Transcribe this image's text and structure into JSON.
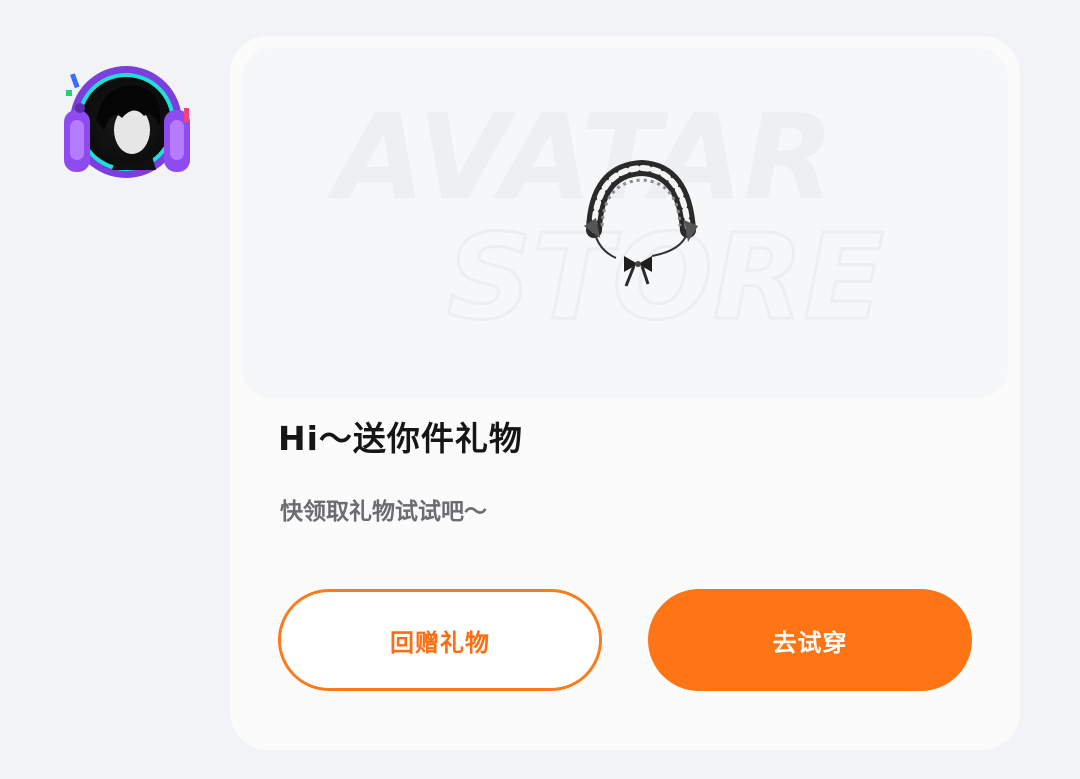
{
  "sender": {
    "avatar_icon": "headphone-avatar-icon"
  },
  "card": {
    "banner": {
      "watermark_line1": "AVATAR",
      "watermark_line2": "STORE",
      "item_icon": "maid-headband-icon"
    },
    "title": "Hi～送你件礼物",
    "subtitle": "快领取礼物试试吧～",
    "buttons": {
      "gift_back_label": "回赠礼物",
      "try_on_label": "去试穿"
    }
  },
  "colors": {
    "accent": "#ff7414",
    "background": "#f2f3f6",
    "card": "#fbfbfc",
    "title": "#161616",
    "subtitle": "#6b6b70"
  }
}
